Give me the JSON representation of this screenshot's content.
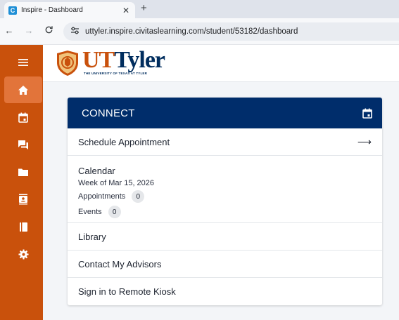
{
  "browser": {
    "tab_favicon": "C",
    "tab_title": "Inspire - Dashboard",
    "tab_close": "✕",
    "new_tab": "+",
    "back": "←",
    "forward": "→",
    "reload": "C",
    "site_info": "⚙",
    "url": "uttyler.inspire.civitaslearning.com/student/53182/dashboard"
  },
  "sidebar": {
    "items": [
      {
        "icon": "menu-icon"
      },
      {
        "icon": "home-icon",
        "active": true
      },
      {
        "icon": "calendar-icon"
      },
      {
        "icon": "chat-icon"
      },
      {
        "icon": "folder-icon"
      },
      {
        "icon": "contacts-icon"
      },
      {
        "icon": "book-icon"
      },
      {
        "icon": "settings-icon"
      }
    ]
  },
  "logo": {
    "ut": "UT",
    "tyler": "Tyler",
    "subtitle": "THE UNIVERSITY OF TEXAS AT TYLER"
  },
  "connect": {
    "title": "CONNECT",
    "schedule": "Schedule Appointment",
    "schedule_arrow": "⟶",
    "calendar": {
      "title": "Calendar",
      "week": "Week of Mar 15, 2026",
      "appointments_label": "Appointments",
      "appointments_count": "0",
      "events_label": "Events",
      "events_count": "0"
    },
    "library": "Library",
    "advisors": "Contact My Advisors",
    "kiosk": "Sign in to Remote Kiosk"
  },
  "colors": {
    "sidebar": "#c9510c",
    "sidebar_active": "#e2743a",
    "card_header": "#002d6b",
    "brand_orange": "#c9510c",
    "brand_navy": "#002d5e"
  }
}
